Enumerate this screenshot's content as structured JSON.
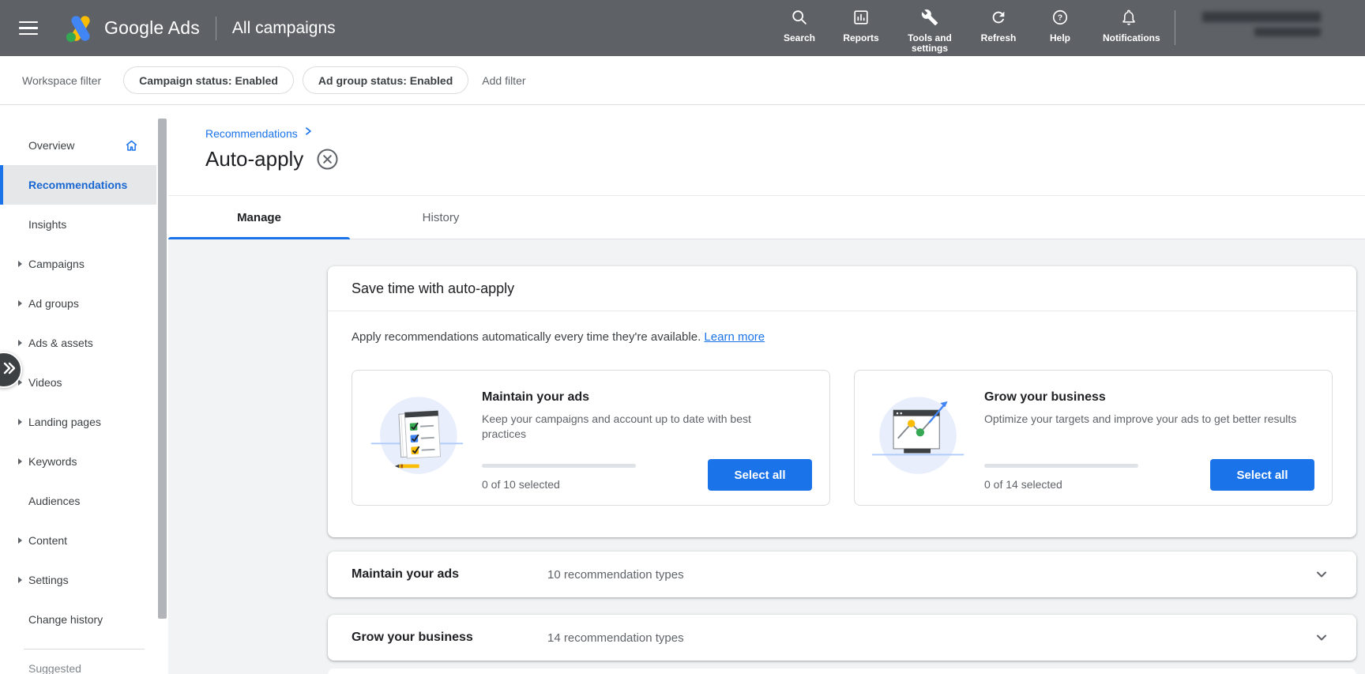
{
  "header": {
    "product_name": "Google Ads",
    "context": "All campaigns",
    "nav": [
      {
        "label": "Search",
        "icon": "search-icon"
      },
      {
        "label": "Reports",
        "icon": "reports-icon"
      },
      {
        "label": "Tools and settings",
        "icon": "wrench-icon"
      },
      {
        "label": "Refresh",
        "icon": "refresh-icon"
      },
      {
        "label": "Help",
        "icon": "help-icon"
      },
      {
        "label": "Notifications",
        "icon": "bell-icon"
      }
    ]
  },
  "filter_bar": {
    "workspace_label": "Workspace filter",
    "pills": [
      "Campaign status: Enabled",
      "Ad group status: Enabled"
    ],
    "add_filter_label": "Add filter"
  },
  "sidebar": {
    "items": [
      {
        "label": "Overview",
        "icon": "home-icon"
      },
      {
        "label": "Recommendations",
        "selected": true
      },
      {
        "label": "Insights"
      },
      {
        "label": "Campaigns",
        "expandable": true
      },
      {
        "label": "Ad groups",
        "expandable": true
      },
      {
        "label": "Ads & assets",
        "expandable": true
      },
      {
        "label": "Videos",
        "expandable": true
      },
      {
        "label": "Landing pages",
        "expandable": true
      },
      {
        "label": "Keywords",
        "expandable": true
      },
      {
        "label": "Audiences"
      },
      {
        "label": "Content",
        "expandable": true
      },
      {
        "label": "Settings",
        "expandable": true
      },
      {
        "label": "Change history"
      }
    ],
    "section_label": "Suggested"
  },
  "page": {
    "breadcrumb_parent": "Recommendations",
    "title": "Auto-apply"
  },
  "tabs": [
    {
      "label": "Manage",
      "active": true
    },
    {
      "label": "History",
      "active": false
    }
  ],
  "auto_apply": {
    "title": "Save time with auto-apply",
    "description": "Apply recommendations automatically every time they're available.",
    "learn_more_label": "Learn more",
    "sections": [
      {
        "title": "Maintain your ads",
        "description": "Keep your campaigns and account up to date with best practices",
        "selected_count": 0,
        "total_count": 10,
        "selected_text": "0 of 10 selected",
        "button_label": "Select all",
        "progress_percent": 0,
        "illustration": "checklist-illustration"
      },
      {
        "title": "Grow your business",
        "description": "Optimize your targets and improve your ads to get better results",
        "selected_count": 0,
        "total_count": 14,
        "selected_text": "0 of 14 selected",
        "button_label": "Select all",
        "progress_percent": 0,
        "illustration": "growth-chart-illustration"
      }
    ]
  },
  "accordions": [
    {
      "title": "Maintain your ads",
      "count_text": "10 recommendation types"
    },
    {
      "title": "Grow your business",
      "count_text": "14 recommendation types"
    }
  ],
  "colors": {
    "header_bg": "#5e6267",
    "accent_blue": "#1a73e8",
    "content_bg": "#f1f3f4",
    "text_primary": "#202124",
    "text_secondary": "#5f6368",
    "logo_yellow": "#fbbc04",
    "logo_blue": "#4285f4",
    "logo_green": "#34a853"
  }
}
